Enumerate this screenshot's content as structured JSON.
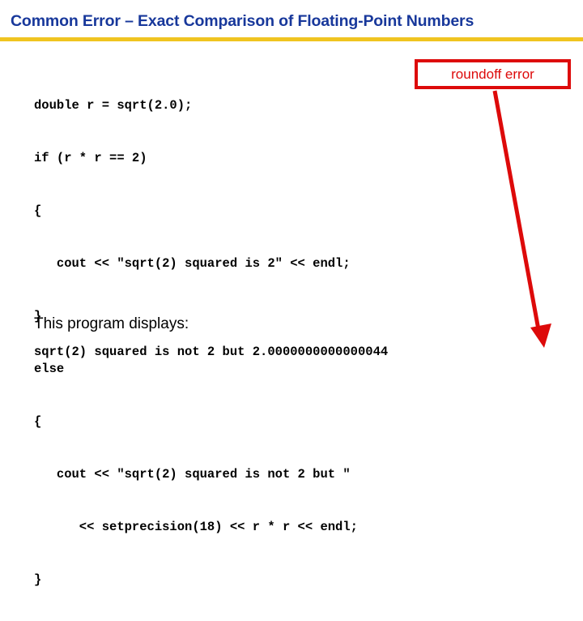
{
  "slide": {
    "title": "Common Error – Exact Comparison of Floating-Point Numbers",
    "title_color": "#18389B",
    "rule_color": "#F0C420",
    "background": "#ffffff"
  },
  "code": {
    "language": "cpp",
    "lines": [
      "double r = sqrt(2.0);",
      "if (r * r == 2)",
      "{",
      "   cout << \"sqrt(2) squared is 2\" << endl;",
      "}",
      "else",
      "{",
      "   cout << \"sqrt(2) squared is not 2 but \"",
      "      << setprecision(18) << r * r << endl;",
      "}"
    ]
  },
  "callout": {
    "label": "roundoff error",
    "color": "#DD0A0A",
    "border_color": "#DD0A0A",
    "arrow_color": "#DD0A0A"
  },
  "output": {
    "intro": "This program displays:",
    "text": "sqrt(2) squared is not 2 but 2.0000000000000044"
  }
}
